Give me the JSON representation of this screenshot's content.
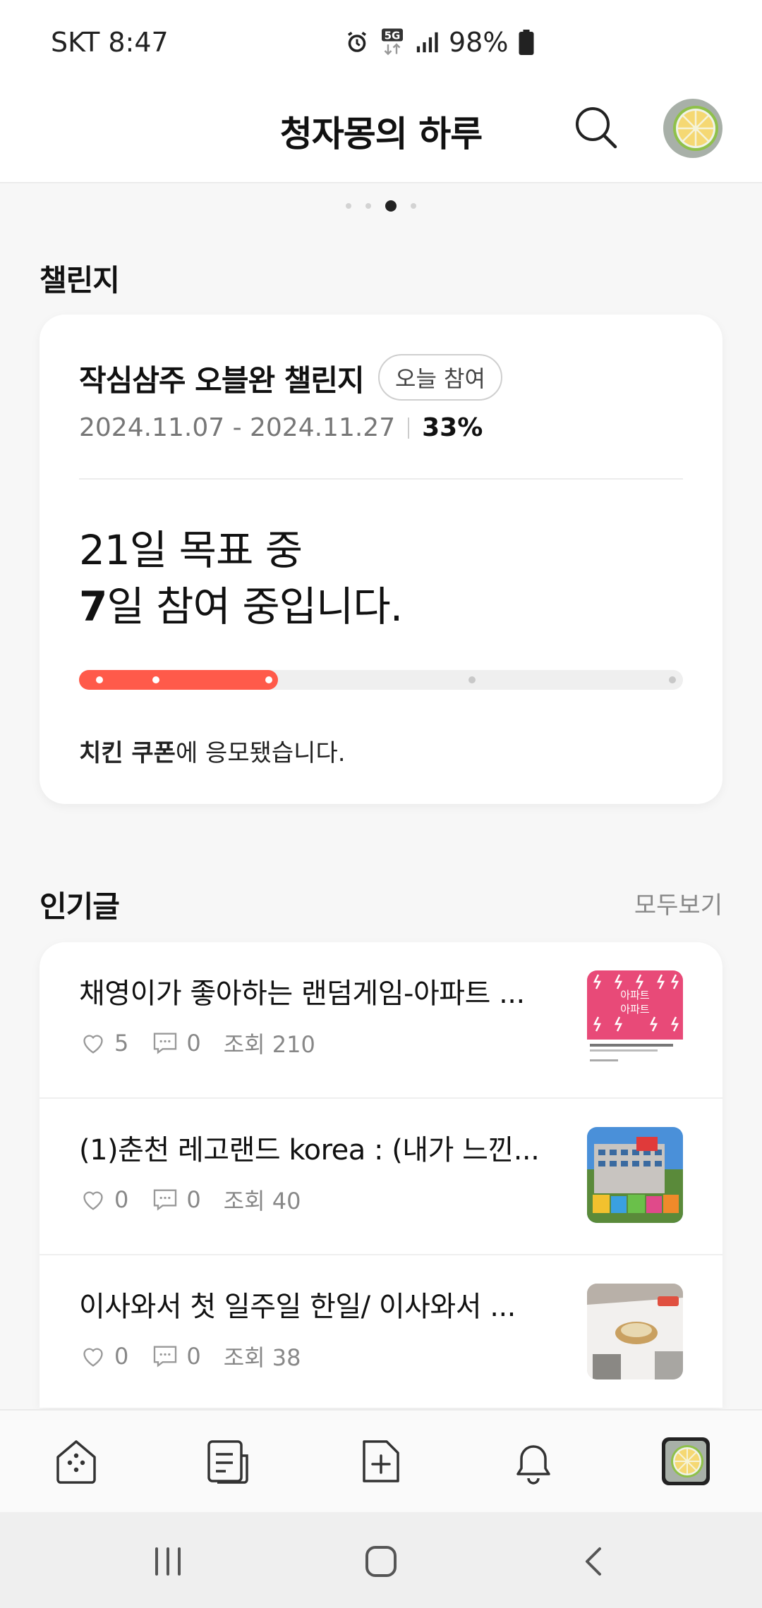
{
  "status_bar": {
    "carrier_time": "SKT 8:47",
    "battery": "98%",
    "network": "5G"
  },
  "header": {
    "title": "청자몽의 하루"
  },
  "pager": {
    "count": 4,
    "active_index": 2
  },
  "challenge_section": {
    "title": "챌린지",
    "card": {
      "name": "작심삼주 오블완 챌린지",
      "badge": "오늘 참여",
      "dates": "2024.11.07 - 2024.11.27",
      "percent": "33%",
      "goal_line1": "21일 목표 중",
      "goal_days": "7",
      "goal_line2_rest": "일 참여 중입니다.",
      "progress_fraction": 0.33,
      "reward_bold": "치킨 쿠폰",
      "reward_rest": "에 응모됐습니다.",
      "accent_color": "#ff5a4a"
    }
  },
  "popular_section": {
    "title": "인기글",
    "see_all": "모두보기",
    "posts": [
      {
        "title": "채영이가 좋아하는 랜덤게임-아파트 ...",
        "likes": "5",
        "comments": "0",
        "views": "조회 210",
        "thumb_text": "아파트\n아파트"
      },
      {
        "title": "(1)춘천 레고랜드 korea : (내가 느낀...",
        "likes": "0",
        "comments": "0",
        "views": "조회 40"
      },
      {
        "title": "이사와서 첫 일주일 한일/ 이사와서 ...",
        "likes": "0",
        "comments": "0",
        "views": "조회 38"
      }
    ]
  },
  "bottom_nav": {
    "items": [
      "home-icon",
      "feed-icon",
      "write-icon",
      "notification-icon",
      "profile-icon"
    ]
  },
  "system_nav": {
    "items": [
      "recent-apps-icon",
      "home-button-icon",
      "back-icon"
    ]
  }
}
